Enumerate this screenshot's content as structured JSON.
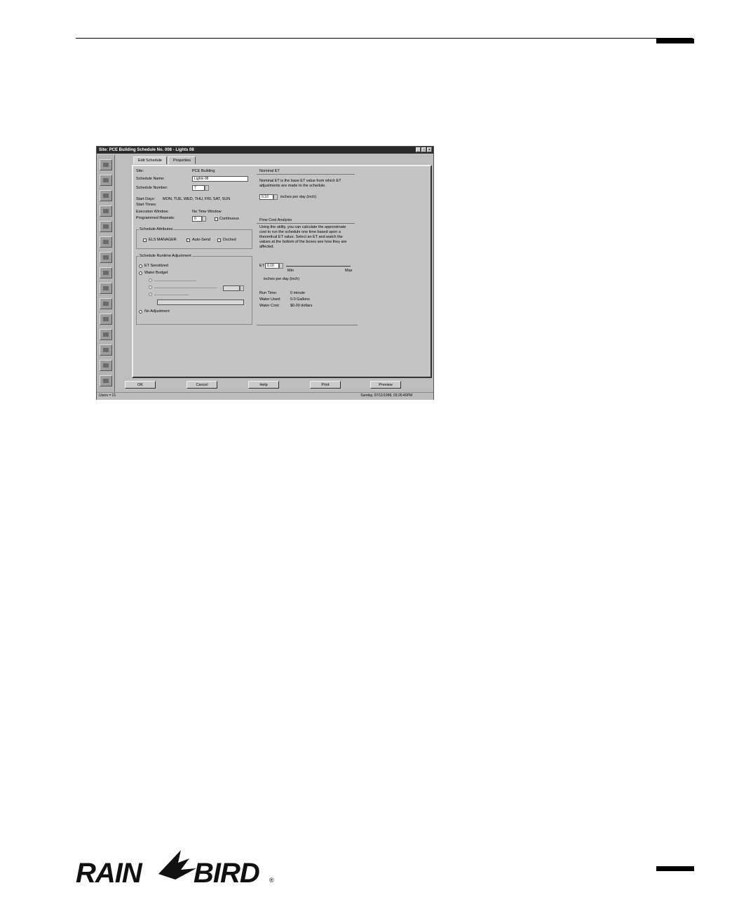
{
  "window": {
    "title": "Site: PCE Building   Schedule No. 008 - Lights 08",
    "buttons": [
      "_",
      "□",
      "×"
    ]
  },
  "tabs": [
    "Edit Schedule",
    "Properties"
  ],
  "left": {
    "site_label": "Site:",
    "site_value": "PCE Building",
    "name_label": "Schedule Name:",
    "name_value": "Lights 08",
    "number_label": "Schedule Number:",
    "number_value": "7",
    "start_days_label": "Start Days:",
    "start_days_value": "MON, TUE, WED, THU, FRI, SAT, SUN",
    "start_times_label": "Start Times:",
    "window_label": "Execution Window:",
    "window_value": "No Time Window",
    "repeats_label": "Programmed Repeats:",
    "repeats_value": "0",
    "continuous_label": "Continuous",
    "attributes_group": "Schedule Attributes",
    "els_label": "ELS MANAGER",
    "autosend_label": "Auto-Send",
    "dsched_label": "Dsched",
    "runtime_group": "Schedule Runtime Adjustment",
    "et_sensitized_label": "ET Sensitized",
    "water_budget_label": "Water Budget",
    "no_adjustment_label": "No Adjustment"
  },
  "right": {
    "nominal_title": "Nominal ET",
    "nominal_desc": "Nominal ET is the base ET value from which ET adjustments are made to the schedule.",
    "nominal_value": "0.10",
    "nominal_unit": "inches per day (inch)",
    "flow_title": "Flow Cost Analysis",
    "flow_desc": "Using the utility, you can calculate the approximate cost to run the schedule one time based upon a theoretical ET value. Select an ET and watch the values at the bottom of the boxes see how they are affected.",
    "et_label": "ET",
    "et_value": "0.10",
    "min_label": "Min",
    "max_label": "Max",
    "et_unit": "inches per day (inch)",
    "runtime_label": "Run Time:",
    "runtime_value": "0 minute",
    "water_used_label": "Water Used:",
    "water_used_value": "0.0 Gallons",
    "water_cost_label": "Water Cost:",
    "water_cost_value": "$0.00 dollars"
  },
  "buttons": {
    "ok": "OK",
    "cancel": "Cancel",
    "help": "Help",
    "print": "Print",
    "preview": "Preview"
  },
  "status": {
    "left": "Users = 21",
    "right": "Sunday, 07/11/1999, 03:26:40PM"
  },
  "logo_text": "RAIN BIRD"
}
